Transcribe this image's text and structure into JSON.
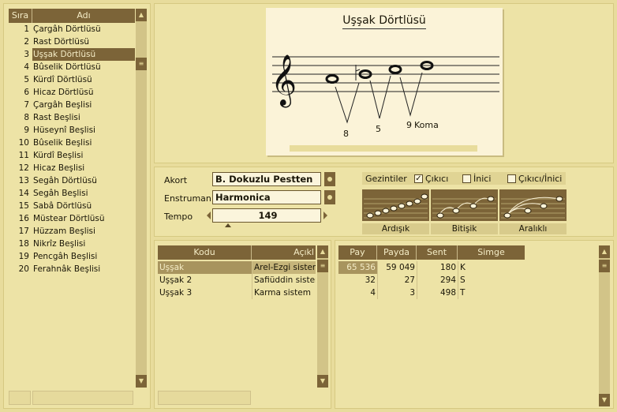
{
  "list": {
    "col_sira": "Sıra",
    "col_adi": "Adı",
    "rows": [
      {
        "n": "1",
        "name": "Çargâh Dörtlüsü"
      },
      {
        "n": "2",
        "name": "Rast Dörtlüsü"
      },
      {
        "n": "3",
        "name": "Uşşak Dörtlüsü"
      },
      {
        "n": "4",
        "name": "Bûselik Dörtlüsü"
      },
      {
        "n": "5",
        "name": "Kürdî Dörtlüsü"
      },
      {
        "n": "6",
        "name": "Hicaz Dörtlüsü"
      },
      {
        "n": "7",
        "name": "Çargâh Beşlisi"
      },
      {
        "n": "8",
        "name": "Rast Beşlisi"
      },
      {
        "n": "9",
        "name": "Hüseynî Beşlisi"
      },
      {
        "n": "10",
        "name": "Bûselik Beşlisi"
      },
      {
        "n": "11",
        "name": "Kürdî Beşlisi"
      },
      {
        "n": "12",
        "name": "Hicaz Beşlisi"
      },
      {
        "n": "13",
        "name": "Segâh Dörtlüsü"
      },
      {
        "n": "14",
        "name": "Segâh Beşlisi"
      },
      {
        "n": "15",
        "name": "Sabâ Dörtlüsü"
      },
      {
        "n": "16",
        "name": "Müstear Dörtlüsü"
      },
      {
        "n": "17",
        "name": "Hüzzam Beşlisi"
      },
      {
        "n": "18",
        "name": "Nikrîz Beşlisi"
      },
      {
        "n": "19",
        "name": "Pencgâh Beşlisi"
      },
      {
        "n": "20",
        "name": "Ferahnâk Beşlisi"
      }
    ],
    "selected_index": 2
  },
  "staff": {
    "title": "Uşşak Dörtlüsü",
    "intervals": [
      "8",
      "5",
      "9"
    ],
    "unit": "Koma"
  },
  "controls": {
    "akort_label": "Akort",
    "akort_value": "B. Dokuzlu Pestten",
    "enstruman_label": "Enstruman",
    "enstruman_value": "Harmonica",
    "tempo_label": "Tempo",
    "tempo_value": "149"
  },
  "gezintiler": {
    "label": "Gezintiler",
    "options": [
      {
        "label": "Çıkıcı",
        "checked": true
      },
      {
        "label": "İnici",
        "checked": false
      },
      {
        "label": "Çıkıcı/İnici",
        "checked": false
      }
    ],
    "modes": [
      "Ardışık",
      "Bitişik",
      "Aralıklı"
    ]
  },
  "codes": {
    "col_kodu": "Kodu",
    "col_aciklama": "Açıkl",
    "rows": [
      {
        "kodu": "Uşşak",
        "aciklama": "Arel-Ezgi sistemi"
      },
      {
        "kodu": "Uşşak 2",
        "aciklama": "Safiüddin sistemi"
      },
      {
        "kodu": "Uşşak 3",
        "aciklama": "Karma sistem"
      }
    ]
  },
  "ratios": {
    "cols": [
      "Pay",
      "Payda",
      "Sent",
      "Simge"
    ],
    "rows": [
      {
        "pay": "65 536",
        "payda": "59 049",
        "sent": "180",
        "simge": "K"
      },
      {
        "pay": "32",
        "payda": "27",
        "sent": "294",
        "simge": "S"
      },
      {
        "pay": "4",
        "payda": "3",
        "sent": "498",
        "simge": "T"
      }
    ]
  }
}
